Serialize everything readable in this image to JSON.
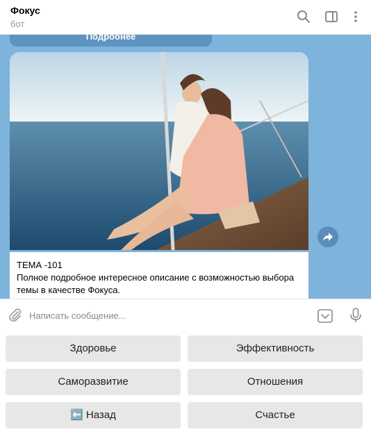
{
  "header": {
    "title": "Фокус",
    "subtitle": "бот"
  },
  "chat": {
    "prev_button_label": "Подробнее",
    "message": {
      "title": "ТЕМА -101",
      "text": "Полное подробное интересное описание с возможностью выбора темы в качестве Фокуса."
    }
  },
  "composer": {
    "placeholder": "Написать сообщение..."
  },
  "keyboard": {
    "buttons": [
      "Здоровье",
      "Эффективность",
      "Саморазвитие",
      "Отношения",
      "⬅️ Назад",
      "Счастье"
    ]
  },
  "colors": {
    "chat_background": "#7eb3dc",
    "button_background": "#e7e7e7"
  }
}
